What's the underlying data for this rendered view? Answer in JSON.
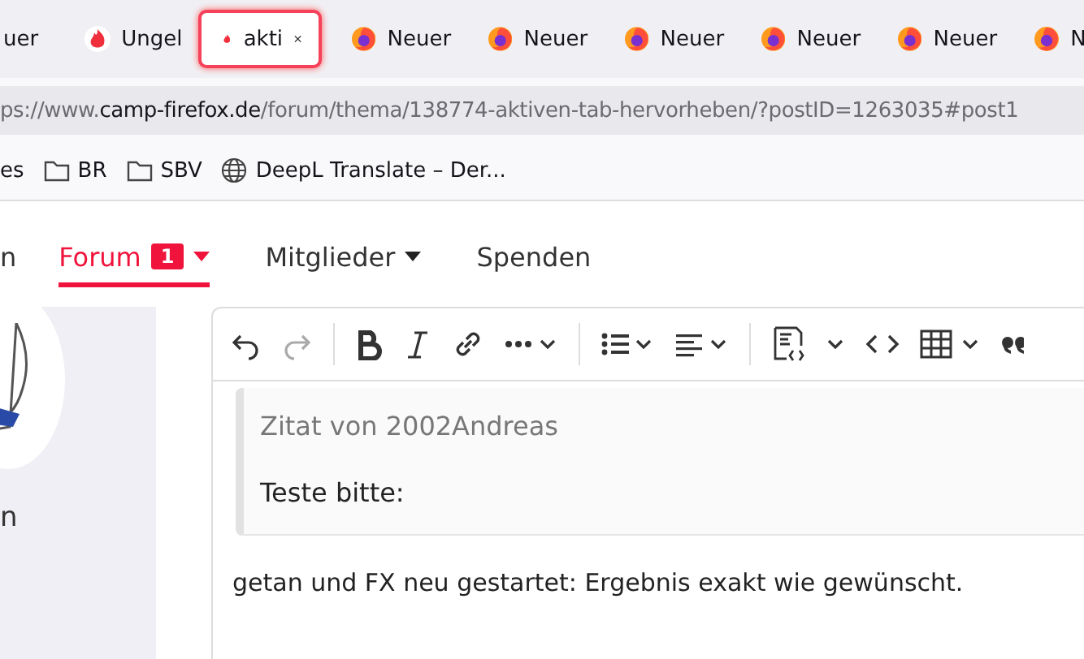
{
  "tabs": [
    {
      "label": "uer",
      "kind": "cut",
      "selected": false
    },
    {
      "label": "Ungel",
      "kind": "forum",
      "selected": false
    },
    {
      "label": "akti",
      "kind": "forum",
      "selected": true
    },
    {
      "label": "Neuer",
      "kind": "newtab",
      "selected": false
    },
    {
      "label": "Neuer",
      "kind": "newtab",
      "selected": false
    },
    {
      "label": "Neuer",
      "kind": "newtab",
      "selected": false
    },
    {
      "label": "Neuer",
      "kind": "newtab",
      "selected": false
    },
    {
      "label": "Neuer",
      "kind": "newtab",
      "selected": false
    },
    {
      "label": "N",
      "kind": "newtab",
      "selected": false
    }
  ],
  "address_bar": {
    "scheme": "ps://www.",
    "host": "camp-firefox.de",
    "path": "/forum/thema/138774-aktiven-tab-hervorheben/?postID=1263035#post1"
  },
  "bookmarks": [
    {
      "label": "es",
      "kind": "plain"
    },
    {
      "label": "BR",
      "kind": "folder"
    },
    {
      "label": "SBV",
      "kind": "folder"
    },
    {
      "label": "DeepL Translate – Der...",
      "kind": "web"
    }
  ],
  "site_nav": [
    {
      "label": "n",
      "selected": false,
      "dropdown": false
    },
    {
      "label": "Forum",
      "selected": true,
      "badge": "1",
      "dropdown": true
    },
    {
      "label": "Mitglieder",
      "selected": false,
      "dropdown": true
    },
    {
      "label": "Spenden",
      "selected": false,
      "dropdown": false
    }
  ],
  "sidebar": {
    "name": "n"
  },
  "editor": {
    "toolbar": [
      {
        "kind": "undo",
        "disabled": false
      },
      {
        "kind": "redo",
        "disabled": true
      },
      {
        "kind": "sep"
      },
      {
        "kind": "bold",
        "disabled": false
      },
      {
        "kind": "italic",
        "disabled": false
      },
      {
        "kind": "link",
        "disabled": false
      },
      {
        "kind": "more",
        "disabled": false
      },
      {
        "kind": "sep"
      },
      {
        "kind": "list",
        "disabled": false
      },
      {
        "kind": "align",
        "disabled": false
      },
      {
        "kind": "sep"
      },
      {
        "kind": "source",
        "disabled": false
      },
      {
        "kind": "caret",
        "disabled": false
      },
      {
        "kind": "code",
        "disabled": false
      },
      {
        "kind": "table",
        "disabled": false
      },
      {
        "kind": "quote",
        "disabled": false
      }
    ],
    "quote": {
      "title": "Zitat von 2002Andreas",
      "text": "Teste bitte:"
    },
    "text": "getan und FX neu gestartet: Ergebnis exakt wie gewünscht."
  }
}
